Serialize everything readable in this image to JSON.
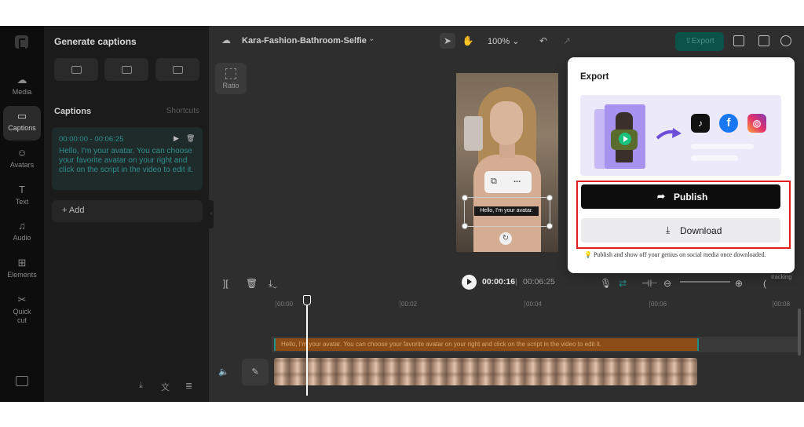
{
  "sidebar": {
    "items": [
      {
        "label": "Media",
        "icon": "cloud-icon"
      },
      {
        "label": "Captions",
        "icon": "captions-icon",
        "active": true
      },
      {
        "label": "Avatars",
        "icon": "avatar-icon"
      },
      {
        "label": "Text",
        "icon": "text-icon"
      },
      {
        "label": "Audio",
        "icon": "music-icon"
      },
      {
        "label": "Elements",
        "icon": "elements-icon"
      },
      {
        "label": "Quick cut",
        "icon": "quick-cut-icon"
      }
    ]
  },
  "panel": {
    "title": "Generate captions",
    "captions_heading": "Captions",
    "shortcuts_label": "Shortcuts",
    "caption": {
      "time_range": "00:00:00 - 00:06:25",
      "text": "Hello, I'm your avatar. You can choose your favorite avatar on your right and click on the script in the video to edit it."
    },
    "add_label": "+ Add"
  },
  "topbar": {
    "project_name": "Kara-Fashion-Bathroom-Selfie",
    "zoom": "100%",
    "export_label": "Export"
  },
  "canvas": {
    "ratio_label": "Ratio",
    "subtitle_chip": "Hello, I'm your avatar.",
    "float_more": "..."
  },
  "timeline": {
    "current_time": "00:00:16",
    "separator": "|",
    "total_time": "00:06:25",
    "tracking_label": "tracking",
    "ticks": [
      "00:00",
      "00:02",
      "00:04",
      "00:06",
      "00:08"
    ],
    "caption_track_text": "Hello, I'm your avatar. You can choose your favorite avatar on your right and click on the script in the video to edit it."
  },
  "export_popup": {
    "title": "Export",
    "social": {
      "tiktok": "TikTok",
      "facebook": "f",
      "instagram": "◎"
    },
    "publish_label": "Publish",
    "download_label": "Download",
    "note": "Publish and show off your genius on social media once downloaded."
  },
  "colors": {
    "accent": "#1e8f87",
    "highlight_box": "#e01e1e",
    "publish_bg": "#0d0d0d"
  }
}
